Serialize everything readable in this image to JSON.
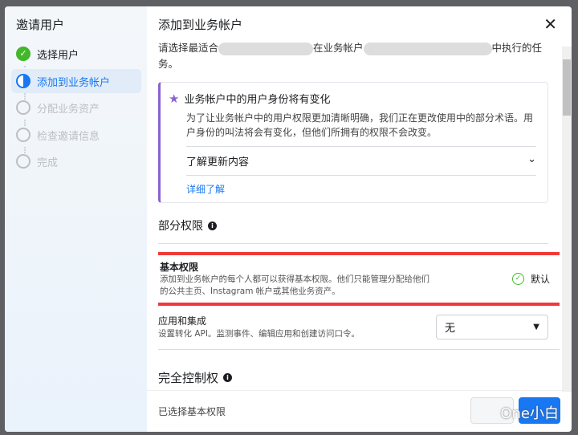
{
  "sidebar": {
    "title": "邀请用户",
    "steps": [
      {
        "label": "选择用户",
        "state": "done"
      },
      {
        "label": "添加到业务帐户",
        "state": "current"
      },
      {
        "label": "分配业务资产",
        "state": "todo"
      },
      {
        "label": "检查邀请信息",
        "state": "todo"
      },
      {
        "label": "完成",
        "state": "todo"
      }
    ]
  },
  "main": {
    "title": "添加到业务帐户",
    "intro_a": "请选择最适合",
    "intro_b": "在业务帐户",
    "intro_c": "中执行的任务。",
    "notice": {
      "title": "业务帐户中的用户身份将有变化",
      "body": "为了让业务帐户中的用户权限更加清晰明确，我们正在更改使用中的部分术语。用户身份的叫法将会有变化，但他们所拥有的权限不会改变。",
      "expand": "了解更新内容",
      "link": "详细了解"
    },
    "partial": {
      "title": "部分权限",
      "basic": {
        "title": "基本权限",
        "desc": "添加到业务帐户的每个人都可以获得基本权限。他们只能管理分配给他们的公共主页、Instagram 帐户或其他业务资产。",
        "status": "默认"
      },
      "apps": {
        "title": "应用和集成",
        "desc": "设置转化 API。监测事件、编辑应用和创建访问口令。",
        "value": "无"
      }
    },
    "full": {
      "title": "完全控制权"
    }
  },
  "footer": {
    "status": "已选择基本权限",
    "watermark": "One小白"
  },
  "colors": {
    "accent": "#1877f2",
    "highlight": "#f03a3a",
    "notice": "#8a63d2"
  }
}
